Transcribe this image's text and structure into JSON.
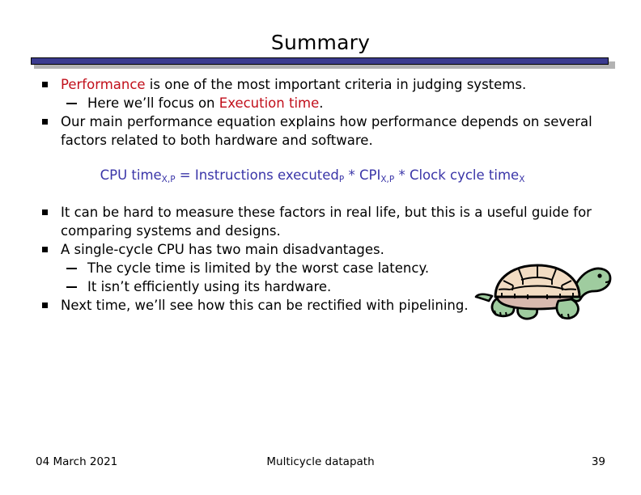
{
  "slide": {
    "title": "Summary",
    "bullets": [
      {
        "level": 1,
        "segments": [
          {
            "text": "Performance",
            "color": "red"
          },
          {
            "text": " is one of the most important criteria in judging systems.",
            "color": "black"
          }
        ]
      },
      {
        "level": 2,
        "segments": [
          {
            "text": "Here we’ll focus on ",
            "color": "black"
          },
          {
            "text": "Execution time",
            "color": "red"
          },
          {
            "text": ".",
            "color": "black"
          }
        ]
      },
      {
        "level": 1,
        "segments": [
          {
            "text": "Our main performance equation explains how performance depends on several factors related to both hardware and software.",
            "color": "black"
          }
        ]
      }
    ],
    "equation": {
      "parts": [
        {
          "text": "CPU time",
          "sub": "X,P"
        },
        {
          "text": " = Instructions executed",
          "sub": "P"
        },
        {
          "text": " * CPI",
          "sub": "X,P"
        },
        {
          "text": " * Clock cycle time",
          "sub": "X"
        }
      ],
      "color": "#3a35a8"
    },
    "bullets_after": [
      {
        "level": 1,
        "segments": [
          {
            "text": "It can be hard to measure these factors in real life, but this is a useful guide for comparing systems and designs.",
            "color": "black"
          }
        ]
      },
      {
        "level": 1,
        "segments": [
          {
            "text": "A single-cycle CPU has two main disadvantages.",
            "color": "black"
          }
        ]
      },
      {
        "level": 2,
        "segments": [
          {
            "text": "The cycle time is limited by the worst case latency.",
            "color": "black"
          }
        ]
      },
      {
        "level": 2,
        "segments": [
          {
            "text": "It isn’t efficiently using its hardware.",
            "color": "black"
          }
        ]
      },
      {
        "level": 1,
        "segments": [
          {
            "text": "Next time, we’ll see how this can be rectified with pipelining.",
            "color": "black"
          }
        ]
      }
    ],
    "image": {
      "name": "tortoise-clipart",
      "description": "Cartoon tortoise",
      "shell_color": "#f2dcc3",
      "body_color": "#9fcc9f",
      "outline_color": "#000000"
    },
    "colors": {
      "accent_red": "#c10f1b",
      "equation_blue": "#3a35a8",
      "rule_navy": "#3b3b8f",
      "rule_shadow": "#b3b3b3"
    }
  },
  "footer": {
    "date": "04 March 2021",
    "center": "Multicycle datapath",
    "page_number": "39"
  }
}
